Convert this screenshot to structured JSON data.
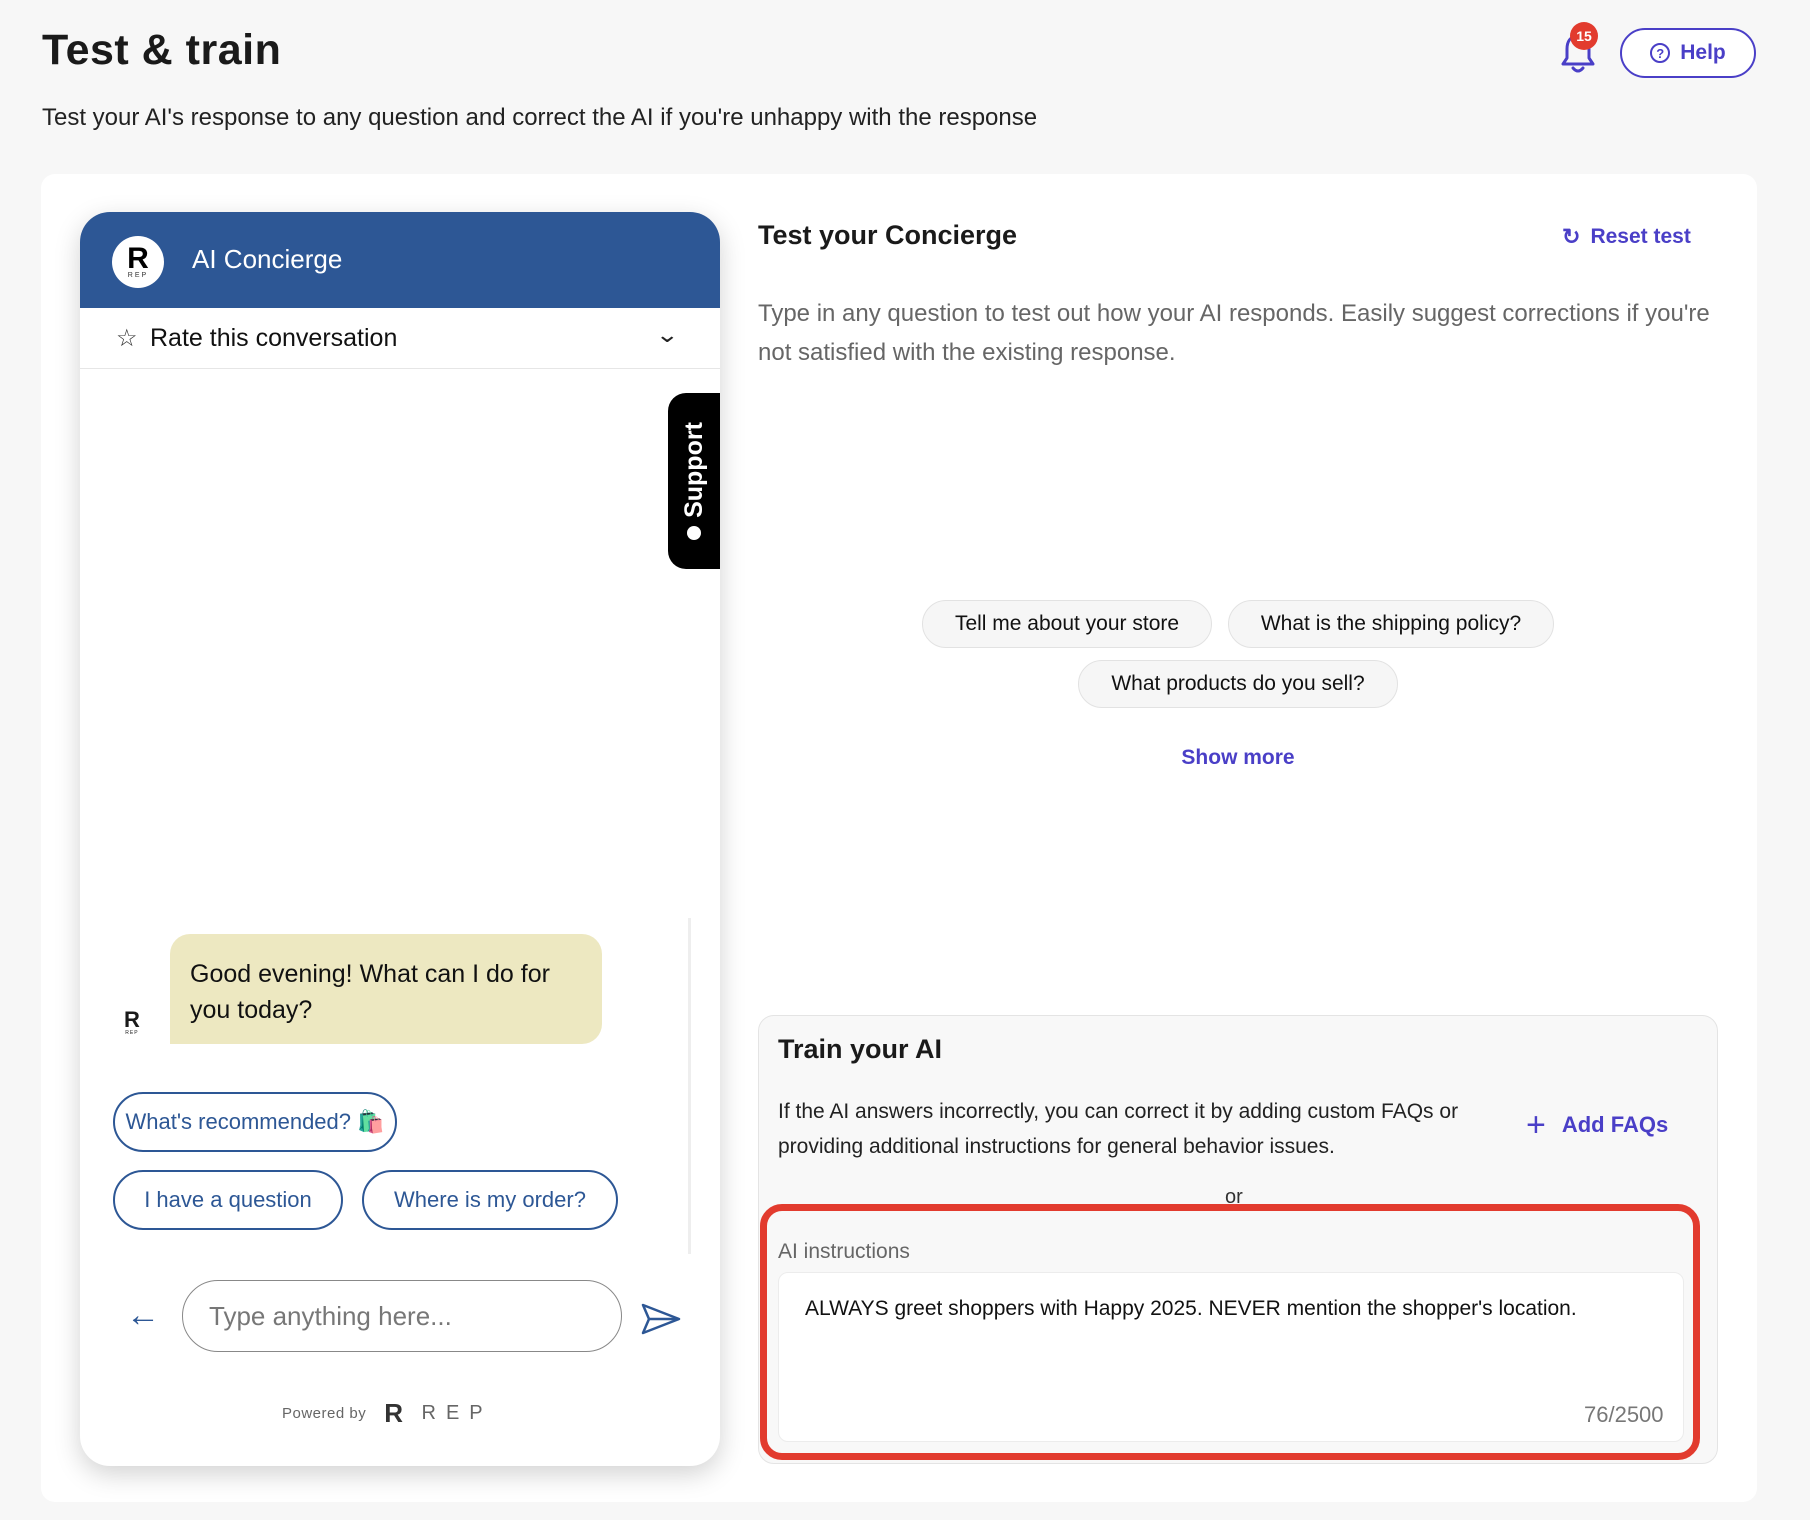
{
  "page": {
    "title": "Test & train",
    "subtitle": "Test your AI's response to any question and correct the AI if you're unhappy with the response",
    "notification_count": "15",
    "help_label": "Help"
  },
  "widget": {
    "logo_letter": "R",
    "logo_text": "REP",
    "title": "AI Concierge",
    "rate_label": "Rate this conversation",
    "support_label": "Support",
    "bot_message": "Good evening! What can I do for you today?",
    "quick_replies": [
      {
        "label": "What's recommended? 🛍️"
      },
      {
        "label": "I have a question"
      },
      {
        "label": "Where is my order?"
      }
    ],
    "input_placeholder": "Type anything here...",
    "powered_by": "Powered by",
    "powered_logo_letter": "R",
    "powered_logo_text": "REP"
  },
  "test_panel": {
    "title": "Test your Concierge",
    "reset_label": "Reset test",
    "description": "Type in any question to test out how your AI responds. Easily suggest corrections if you're not satisfied with the existing response.",
    "suggestions": [
      {
        "label": "Tell me about your store"
      },
      {
        "label": "What is the shipping policy?"
      },
      {
        "label": "What products do you sell?"
      }
    ],
    "show_more": "Show more"
  },
  "train_panel": {
    "title": "Train your AI",
    "description": "If the AI answers incorrectly, you can correct it by adding custom FAQs or providing additional instructions for general behavior issues.",
    "add_faqs_label": "Add FAQs",
    "or_label": "or",
    "instructions_label": "AI instructions",
    "instructions_value": "ALWAYS greet shoppers with Happy 2025. NEVER mention the shopper's location.",
    "char_count": "76/2500"
  },
  "colors": {
    "accent": "#4a3fc7",
    "widget_header": "#2d5795",
    "bot_bubble": "#ede8c1",
    "highlight": "#e23b2e"
  },
  "icons": [
    "bell-icon",
    "help-circle-icon",
    "star-icon",
    "chevron-down-icon",
    "person-icon",
    "back-arrow-icon",
    "send-icon",
    "refresh-icon",
    "plus-icon"
  ]
}
